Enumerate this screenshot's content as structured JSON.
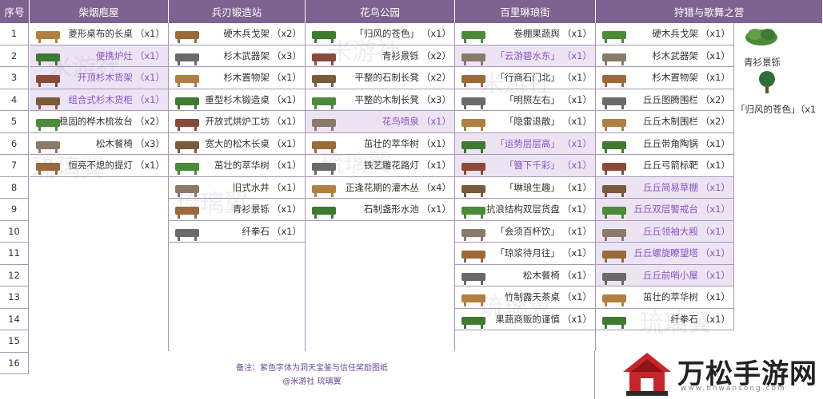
{
  "headers": {
    "index": "序号",
    "col1": "柴烟庖屋",
    "col2": "兵刃锻造站",
    "col3": "花鸟公园",
    "col4": "百里琳琅街",
    "col5": "狩猎与歌舞之营"
  },
  "row_numbers": [
    "1",
    "2",
    "3",
    "4",
    "5",
    "6",
    "7",
    "8",
    "9",
    "10",
    "11",
    "12",
    "13",
    "14",
    "15",
    "16"
  ],
  "col1_items": [
    {
      "name": "菱形桌布的长桌",
      "qty": "（x1）",
      "purple": false
    },
    {
      "name": "便携炉灶",
      "qty": "（x1）",
      "purple": true
    },
    {
      "name": "开顶杉木货架",
      "qty": "（x1）",
      "purple": true
    },
    {
      "name": "组合式杉木货柜",
      "qty": "（x1）",
      "purple": true
    },
    {
      "name": "稳固的桦木梳妆台",
      "qty": "（x2）",
      "purple": false
    },
    {
      "name": "松木餐椅",
      "qty": "（x3）",
      "purple": false
    },
    {
      "name": "恒亮不熄的提灯",
      "qty": "（x1）",
      "purple": false
    }
  ],
  "col2_items": [
    {
      "name": "硬木兵戈架",
      "qty": "（x2）",
      "purple": false
    },
    {
      "name": "杉木武器架",
      "qty": "（x3）",
      "purple": false
    },
    {
      "name": "杉木置物架",
      "qty": "（x1）",
      "purple": false
    },
    {
      "name": "重型杉木锻造桌",
      "qty": "（x1）",
      "purple": false
    },
    {
      "name": "开放式烘炉工坊",
      "qty": "（x1）",
      "purple": false
    },
    {
      "name": "宽大的松木长桌",
      "qty": "（x1）",
      "purple": false
    },
    {
      "name": "茁壮的萃华树",
      "qty": "（x1）",
      "purple": false
    },
    {
      "name": "旧式水井",
      "qty": "（x1）",
      "purple": false
    },
    {
      "name": "青衫景铄",
      "qty": "（x1）",
      "purple": false
    },
    {
      "name": "纤拳石",
      "qty": "（x1）",
      "purple": false
    }
  ],
  "col3_items": [
    {
      "name": "「归风的苍色」",
      "qty": "（x1）",
      "purple": false
    },
    {
      "name": "青衫景铄",
      "qty": "（x2）",
      "purple": false
    },
    {
      "name": "平整的石制长凳",
      "qty": "（x2）",
      "purple": false
    },
    {
      "name": "平整的木制长凳",
      "qty": "（x3）",
      "purple": false
    },
    {
      "name": "花鸟喷泉",
      "qty": "（x1）",
      "purple": true
    },
    {
      "name": "茁壮的萃华树",
      "qty": "（x1）",
      "purple": false
    },
    {
      "name": "铁艺雕花路灯",
      "qty": "（x1）",
      "purple": false
    },
    {
      "name": "正逢花期的灌木丛",
      "qty": "（x4）",
      "purple": false
    },
    {
      "name": "石制盏形水池",
      "qty": "（x1）",
      "purple": false
    }
  ],
  "col4_items": [
    {
      "name": "卷棚果蔬舆",
      "qty": "（x1）",
      "purple": false
    },
    {
      "name": "「云游碧水东」",
      "qty": "（x1）",
      "purple": true
    },
    {
      "name": "「行商石门北」",
      "qty": "（x1）",
      "purple": false
    },
    {
      "name": "「明照左右」",
      "qty": "（x1）",
      "purple": false
    },
    {
      "name": "「隐雷退散」",
      "qty": "（x1）",
      "purple": false
    },
    {
      "name": "「运势层层高」",
      "qty": "（x1）",
      "purple": true
    },
    {
      "name": "「簪下千彩」",
      "qty": "（x1）",
      "purple": true
    },
    {
      "name": "「琳琅生趣」",
      "qty": "（x1）",
      "purple": false
    },
    {
      "name": "抗浪结构双层货盘",
      "qty": "（x1）",
      "purple": false
    },
    {
      "name": "「会须百杯饮」",
      "qty": "（x1）",
      "purple": false
    },
    {
      "name": "「琼浆待月往」",
      "qty": "（x1）",
      "purple": false
    },
    {
      "name": "松木餐椅",
      "qty": "（x1）",
      "purple": false
    },
    {
      "name": "竹制露天茶桌",
      "qty": "（x1）",
      "purple": false
    },
    {
      "name": "果蔬商贩的谨慎",
      "qty": "（x1）",
      "purple": false
    }
  ],
  "col5_items": [
    {
      "name": "硬木兵戈架",
      "qty": "（x1）",
      "purple": false
    },
    {
      "name": "杉木武器架",
      "qty": "（x1）",
      "purple": false
    },
    {
      "name": "杉木置物架",
      "qty": "（x1）",
      "purple": false
    },
    {
      "name": "丘丘图腾围栏",
      "qty": "（x2）",
      "purple": false
    },
    {
      "name": "丘丘木制围栏",
      "qty": "（x2）",
      "purple": false
    },
    {
      "name": "丘丘带角陶锅",
      "qty": "（x1）",
      "purple": false
    },
    {
      "name": "丘丘弓箭标靶",
      "qty": "（x1）",
      "purple": false
    },
    {
      "name": "丘丘简易草棚",
      "qty": "（x1）",
      "purple": true
    },
    {
      "name": "丘丘双层警戒台",
      "qty": "（x1）",
      "purple": true
    },
    {
      "name": "丘丘领袖大殿",
      "qty": "（x1）",
      "purple": true
    },
    {
      "name": "丘丘螺旋瞭望塔",
      "qty": "（x1）",
      "purple": true
    },
    {
      "name": "丘丘前哨小屋",
      "qty": "（x1）",
      "purple": true
    },
    {
      "name": "茁壮的萃华树",
      "qty": "（x1）",
      "purple": false
    },
    {
      "name": "纤拳石",
      "qty": "（x1）",
      "purple": false
    }
  ],
  "side_items": {
    "item1": "青衫景铄",
    "item2": "「归风的苍色」",
    "item2_qty": "（x1"
  },
  "note": {
    "line1": "备注：紫色字体为洞天宝鉴与信任奖励图纸",
    "line2": "@米游社  琉璃翼"
  },
  "watermark": {
    "site": "万松手游网",
    "url": "www.hnwansong.com"
  },
  "colors": {
    "header_bg": "#7e6391",
    "purple_text": "#8a55c8",
    "purple_bg": "#ece4f3",
    "border": "#a895b8"
  }
}
